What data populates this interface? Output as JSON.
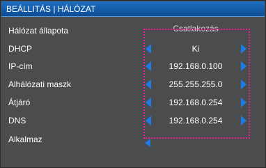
{
  "header": {
    "title": "BEÁLLITÁS | HÁLÓZAT"
  },
  "rows": {
    "status": {
      "label": "Hálózat állapota",
      "value": "Csatlakozás"
    },
    "dhcp": {
      "label": "DHCP",
      "value": "Ki"
    },
    "ip": {
      "label": "IP-cím",
      "value": "192.168.0.100"
    },
    "mask": {
      "label": "Alhálózati maszk",
      "value": "255.255.255.0"
    },
    "gateway": {
      "label": "Átjáró",
      "value": "192.168.0.254"
    },
    "dns": {
      "label": "DNS",
      "value": "192.168.0.254"
    },
    "apply": {
      "label": "Alkalmaz"
    }
  },
  "colors": {
    "panel": "#4a4c4e",
    "header": "#1e6fc0",
    "arrow": "#1f7ce6",
    "focus": "#e5219a"
  },
  "icons": {
    "left": "triangle-left-icon",
    "right": "triangle-right-icon"
  }
}
